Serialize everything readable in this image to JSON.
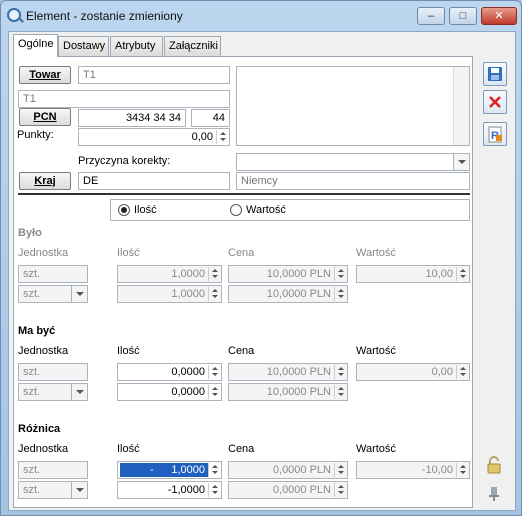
{
  "window": {
    "title": "Element - zostanie zmieniony",
    "minimize": "–",
    "maximize": "□",
    "close": "✕"
  },
  "tabs": [
    "Ogólne",
    "Dostawy",
    "Atrybuty",
    "Załączniki"
  ],
  "towar": {
    "button": "Towar",
    "code": "T1",
    "name": "T1"
  },
  "pcn": {
    "button": "PCN",
    "code": "3434 34 34",
    "suffix": "44"
  },
  "punkty": {
    "label": "Punkty:",
    "value": "0,00"
  },
  "korekta": {
    "label": "Przyczyna korekty:",
    "value": ""
  },
  "kraj": {
    "button": "Kraj",
    "code": "DE",
    "name": "Niemcy"
  },
  "mode": {
    "ilosc": "Ilość",
    "wartosc": "Wartość",
    "selected": "ilosc"
  },
  "cols": {
    "jednostka": "Jednostka",
    "ilosc": "Ilość",
    "cena": "Cena",
    "wartosc": "Wartość"
  },
  "bylo": {
    "title": "Było",
    "unit1": "szt.",
    "unit2": "szt.",
    "qty1": "1,0000",
    "qty2": "1,0000",
    "price1": "10,0000 PLN",
    "price2": "10,0000 PLN",
    "value": "10,00"
  },
  "mabyc": {
    "title": "Ma być",
    "unit1": "szt.",
    "unit2": "szt.",
    "qty1": "0,0000",
    "qty2": "0,0000",
    "price1": "10,0000 PLN",
    "price2": "10,0000 PLN",
    "value": "0,00"
  },
  "roznica": {
    "title": "Różnica",
    "unit1": "szt.",
    "unit2": "szt.",
    "qty1_sign": "-",
    "qty1": "1,0000",
    "qty2": "-1,0000",
    "price1": "0,0000 PLN",
    "price2": "0,0000 PLN",
    "value": "-10,00"
  },
  "side": {
    "save": "save-icon",
    "cancel": "close-icon",
    "report": "report-icon",
    "lock": "lock-icon",
    "pin": "pin-icon"
  },
  "colors": {
    "accent": "#1f5fbf",
    "cancel": "#d22",
    "title_bar": "#bcd6ef"
  }
}
